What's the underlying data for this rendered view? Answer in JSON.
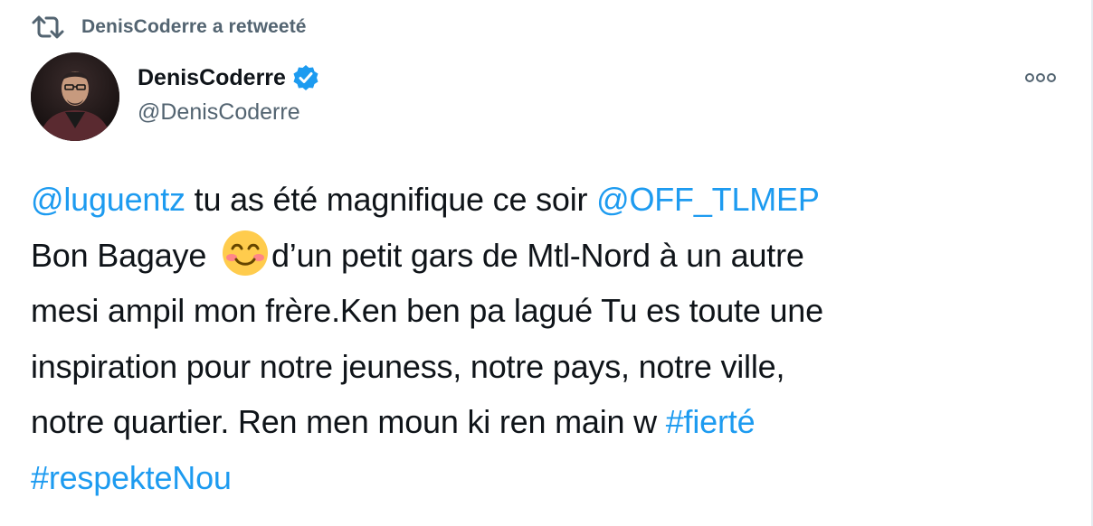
{
  "retweet_context": {
    "icon": "retweet-icon",
    "label": "DenisCoderre a retweeté"
  },
  "author": {
    "display_name": "DenisCoderre",
    "handle": "@DenisCoderre",
    "verified_icon": "verified-badge-icon",
    "avatar_icon": "avatar-photo"
  },
  "more_menu": {
    "icon": "more-options-icon"
  },
  "tweet": {
    "line1": {
      "mention1": "@luguentz",
      "text": " tu as été magnifique ce soir ",
      "mention2": "@OFF_TLMEP"
    },
    "line2": {
      "text_before": "Bon Bagaye ",
      "emoji": "smiling-face-with-smiling-eyes-emoji",
      "text_after": "d’un petit gars de Mtl-Nord à un autre"
    },
    "line3": "mesi ampil mon frère.Ken ben pa lagué Tu es toute une",
    "line4": "inspiration pour notre jeuness, notre pays, notre ville,",
    "line5": {
      "text": "notre quartier. Ren men moun ki ren main w ",
      "hashtag1": "#fierté"
    },
    "line6": {
      "hashtag2": "#respekteNou"
    }
  },
  "colors": {
    "link": "#1d9bf0",
    "text_primary": "#0f1419",
    "text_secondary": "#536471",
    "verified": "#1d9bf0"
  }
}
